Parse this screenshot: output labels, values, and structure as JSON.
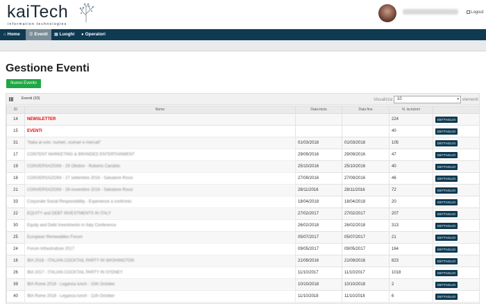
{
  "header": {
    "logo_main": "kaiTech",
    "logo_sub": "information technologies",
    "user_email": "",
    "logout_label": "Logout"
  },
  "nav": {
    "items": [
      {
        "label": "Home",
        "icon": "home-icon"
      },
      {
        "label": "Eventi",
        "icon": "list-icon",
        "active": true
      },
      {
        "label": "Luoghi",
        "icon": "building-icon"
      },
      {
        "label": "Operatori",
        "icon": "user-icon"
      }
    ]
  },
  "page": {
    "title": "Gestione Eventi",
    "new_button": "Nuovo Evento"
  },
  "panel": {
    "title": "Eventi (33)",
    "visualizza_label": "Visualizza",
    "page_size": "10",
    "elementi_label": "elementi"
  },
  "table": {
    "columns": [
      "ID",
      "Nome",
      "Data inizio",
      "Data fine",
      "N. iscrizioni",
      ""
    ],
    "action_label": "DETTAGLIO",
    "rows": [
      {
        "id": "14",
        "name": "NEWSLETTER",
        "start": "",
        "end": "",
        "count": "224",
        "style": "red"
      },
      {
        "id": "15",
        "name": "EVENTI",
        "start": "",
        "end": "",
        "count": "40",
        "style": "red"
      },
      {
        "id": "31",
        "name": "\"Italia al volo: numeri, scenari e mercati\"",
        "start": "01/03/2018",
        "end": "01/03/2018",
        "count": "105",
        "style": "blur"
      },
      {
        "id": "17",
        "name": "CONTENT MARKETING & BRANDED ENTERTAINMENT",
        "start": "29/09/2016",
        "end": "29/09/2016",
        "count": "47",
        "style": "blur"
      },
      {
        "id": "19",
        "name": "CONVERSAZIONI - 25 Ottobre - Roberto Candido",
        "start": "25/10/2016",
        "end": "25/10/2016",
        "count": "40",
        "style": "blur"
      },
      {
        "id": "18",
        "name": "CONVERSAZIONI - 27 settembre 2016 - Salvatore Rossi",
        "start": "27/09/2016",
        "end": "27/09/2016",
        "count": "46",
        "style": "blur"
      },
      {
        "id": "21",
        "name": "CONVERSAZIONI - 28 novembre 2016 - Salvatore Rossi",
        "start": "28/11/2016",
        "end": "28/11/2016",
        "count": "72",
        "style": "blur"
      },
      {
        "id": "33",
        "name": "Corporate Social Responsibility - Esperienze a confronto",
        "start": "18/04/2018",
        "end": "18/04/2018",
        "count": "20",
        "style": "blur"
      },
      {
        "id": "22",
        "name": "EQUITY and DEBT INVESTMENTS IN ITALY",
        "start": "27/02/2017",
        "end": "27/02/2017",
        "count": "207",
        "style": "blur"
      },
      {
        "id": "30",
        "name": "Equity and Debt Investments in Italy Conference",
        "start": "26/02/2018",
        "end": "26/02/2018",
        "count": "313",
        "style": "blur"
      },
      {
        "id": "25",
        "name": "European Renewables Forum",
        "start": "05/07/2017",
        "end": "05/07/2017",
        "count": "21",
        "style": "blur"
      },
      {
        "id": "24",
        "name": "Forum Infrastrutture 2017",
        "start": "09/05/2017",
        "end": "09/05/2017",
        "count": "164",
        "style": "blur"
      },
      {
        "id": "16",
        "name": "IBA 2016 - ITALIAN COCKTAIL PARTY IN WASHINGTON",
        "start": "21/09/2016",
        "end": "21/09/2016",
        "count": "823",
        "style": "blur"
      },
      {
        "id": "26",
        "name": "IBA 2017 - ITALIAN COCKTAIL PARTY IN SYDNEY",
        "start": "11/10/2017",
        "end": "11/10/2017",
        "count": "1018",
        "style": "blur"
      },
      {
        "id": "39",
        "name": "IBA Rome 2018 - Leganza lunch - 10th October",
        "start": "10/10/2018",
        "end": "10/10/2018",
        "count": "2",
        "style": "blur"
      },
      {
        "id": "40",
        "name": "IBA Rome 2018 - Leganza lunch - 11th October",
        "start": "11/10/2018",
        "end": "11/10/2018",
        "count": "6",
        "style": "blur"
      }
    ]
  },
  "colors": {
    "navbar": "#0e3a52",
    "nav_active": "#7a8d99",
    "new_button": "#1fa743",
    "highlight_red": "#e00000",
    "action_button": "#0e3a52"
  }
}
